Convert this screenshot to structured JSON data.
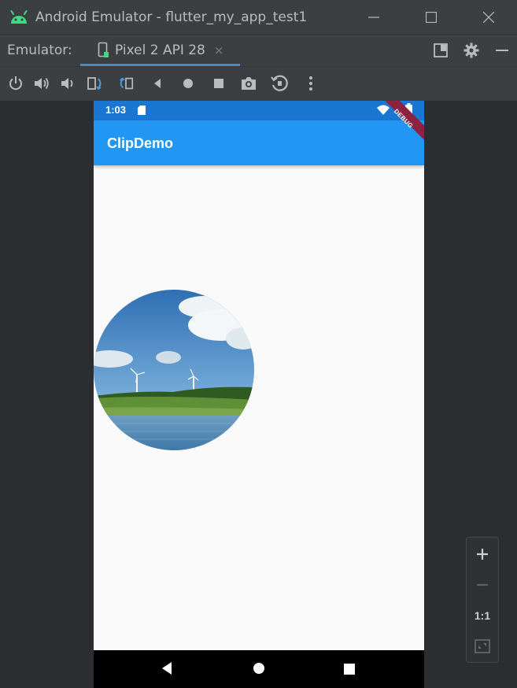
{
  "window": {
    "title": "Android Emulator - flutter_my_app_test1",
    "controls": [
      "minimize",
      "maximize",
      "close"
    ]
  },
  "tabbar": {
    "label": "Emulator:",
    "tab": {
      "label": "Pixel 2 API 28",
      "close": "×"
    }
  },
  "toolbar": {
    "buttons": [
      "power-icon",
      "volume-up-icon",
      "volume-down-icon",
      "rotate-left-icon",
      "rotate-right-icon",
      "back-icon",
      "home-icon",
      "overview-icon",
      "screenshot-icon",
      "snapshot-icon",
      "more-icon"
    ]
  },
  "device": {
    "status_time": "1:03",
    "app_title": "ClipDemo",
    "debug_banner": "DEBUG"
  },
  "zoom": {
    "ratio_label": "1:1"
  },
  "colors": {
    "app_bar": "#2196f3",
    "status_bar": "#1976d2",
    "ide_background": "#2b2d30",
    "tab_underline": "#4a88c7",
    "android_green": "#3ddc84"
  }
}
